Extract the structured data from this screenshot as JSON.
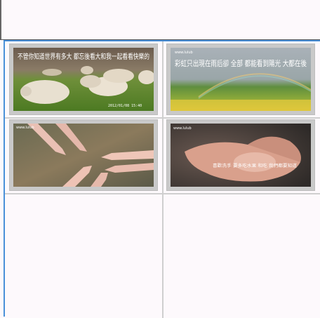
{
  "gallery": {
    "items": [
      {
        "caption": "不管你知道世界有多大 都忘後看大和我一起看看快樂的",
        "date": "2012/01/08 15:40"
      },
      {
        "watermark": "www.lulub",
        "caption": "彩虹只出現在雨后卻 全部 都能看到陽光 大都在後"
      },
      {
        "watermark": "www.lulub"
      },
      {
        "watermark": "www.lulub",
        "caption": "喜歡洗手 要多吃水果 和吃 我們都要知道"
      }
    ]
  },
  "colors": {
    "panel_border": "#4a90d9",
    "divider": "#cfcfcf",
    "thumb_frame": "#c9c9c9"
  }
}
